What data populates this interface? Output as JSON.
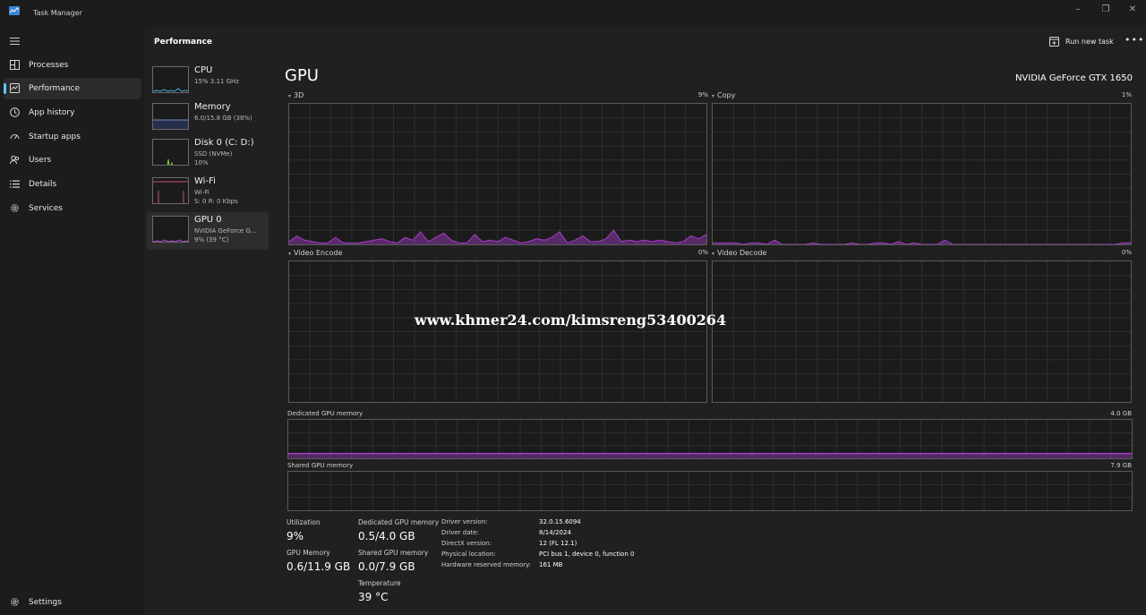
{
  "window": {
    "title": "Task Manager",
    "accent_color": "#5cc8ff"
  },
  "nav": {
    "items": [
      {
        "label": "Processes",
        "icon": "processes-grid-icon"
      },
      {
        "label": "Performance",
        "icon": "performance-monitor-icon"
      },
      {
        "label": "App history",
        "icon": "history-clock-icon"
      },
      {
        "label": "Startup apps",
        "icon": "speedometer-icon"
      },
      {
        "label": "Users",
        "icon": "users-icon"
      },
      {
        "label": "Details",
        "icon": "list-details-icon"
      },
      {
        "label": "Services",
        "icon": "gear-icon"
      }
    ],
    "settings_label": "Settings"
  },
  "header": {
    "title": "Performance",
    "run_task_label": "Run new task",
    "more_label": "•••"
  },
  "devices": [
    {
      "name": "CPU",
      "sub1": "15% 3.11 GHz",
      "sub2": "",
      "color": "#4fa8e0"
    },
    {
      "name": "Memory",
      "sub1": "6.0/15.8 GB (38%)",
      "sub2": "",
      "color": "#6e8ec7"
    },
    {
      "name": "Disk 0 (C: D:)",
      "sub1": "SSD (NVMe)",
      "sub2": "10%",
      "color": "#8bd13a"
    },
    {
      "name": "Wi-Fi",
      "sub1": "Wi-Fi",
      "sub2": "S: 0 R: 0 Kbps",
      "color": "#c9507a"
    },
    {
      "name": "GPU 0",
      "sub1": "NVIDIA GeForce G...",
      "sub2": "9% (39 °C)",
      "color": "#b04ed0"
    }
  ],
  "gpu": {
    "title": "GPU",
    "model": "NVIDIA GeForce GTX 1650",
    "graph_color": "#a43fc7",
    "engines": [
      {
        "label": "3D",
        "percent": "9%",
        "values": [
          2,
          6,
          3,
          2,
          1,
          1,
          5,
          1,
          1,
          1,
          2,
          3,
          4,
          2,
          1,
          5,
          3,
          9,
          2,
          5,
          8,
          3,
          1,
          1,
          7,
          2,
          3,
          2,
          5,
          3,
          1,
          2,
          4,
          3,
          5,
          9,
          1,
          3,
          6,
          2,
          2,
          4,
          10,
          2,
          3,
          2,
          3,
          2,
          3,
          2,
          1,
          2,
          6,
          4,
          7
        ]
      },
      {
        "label": "Copy",
        "percent": "1%",
        "values": [
          1,
          1,
          1,
          1,
          0,
          1,
          1,
          0,
          3,
          0,
          0,
          0,
          0,
          1,
          0,
          0,
          0,
          0,
          1,
          0,
          0,
          1,
          1,
          0,
          2,
          0,
          1,
          0,
          0,
          0,
          3,
          0,
          0,
          0,
          0,
          0,
          0,
          0,
          0,
          0,
          0,
          0,
          0,
          0,
          0,
          0,
          0,
          0,
          0,
          0,
          0,
          0,
          0,
          1,
          1
        ]
      },
      {
        "label": "Video Encode",
        "percent": "0%",
        "values": []
      },
      {
        "label": "Video Decode",
        "percent": "0%",
        "values": []
      }
    ],
    "dedicated_memory": {
      "label": "Dedicated GPU memory",
      "max": "4.0 GB",
      "usage_fraction": 0.125
    },
    "shared_memory": {
      "label": "Shared GPU memory",
      "max": "7.9 GB",
      "usage_fraction": 0.0
    },
    "stats": {
      "utilization_label": "Utilization",
      "utilization": "9%",
      "dedicated_label": "Dedicated GPU memory",
      "dedicated": "0.5/4.0 GB",
      "gpu_memory_label": "GPU Memory",
      "gpu_memory": "0.6/11.9 GB",
      "shared_label": "Shared GPU memory",
      "shared": "0.0/7.9 GB",
      "temperature_label": "Temperature",
      "temperature": "39 °C"
    },
    "properties": [
      {
        "key": "Driver version:",
        "value": "32.0.15.6094"
      },
      {
        "key": "Driver date:",
        "value": "8/14/2024"
      },
      {
        "key": "DirectX version:",
        "value": "12 (FL 12.1)"
      },
      {
        "key": "Physical location:",
        "value": "PCI bus 1, device 0, function 0"
      },
      {
        "key": "Hardware reserved memory:",
        "value": "161 MB"
      }
    ]
  },
  "watermark": "www.khmer24.com/kimsreng53400264"
}
